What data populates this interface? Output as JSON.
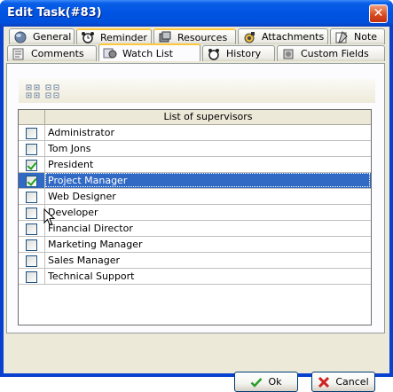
{
  "window": {
    "title": "Edit Task(#83)",
    "close_glyph": "✕"
  },
  "tabs_row1": [
    {
      "label": "General",
      "icon": "globe-icon"
    },
    {
      "label": "Reminder",
      "icon": "alarm-clock-icon"
    },
    {
      "label": "Resources",
      "icon": "resources-icon"
    },
    {
      "label": "Attachments",
      "icon": "attachment-icon"
    },
    {
      "label": "Note",
      "icon": "note-icon"
    }
  ],
  "tabs_row2": [
    {
      "label": "Comments",
      "icon": "comments-icon"
    },
    {
      "label": "Watch List",
      "icon": "watch-list-icon",
      "selected": true
    },
    {
      "label": "History",
      "icon": "history-icon"
    },
    {
      "label": "Custom Fields",
      "icon": "custom-fields-icon"
    }
  ],
  "toolbar": {
    "buttons": [
      "expand-all-icon",
      "collapse-all-icon"
    ]
  },
  "grid": {
    "header": "List of supervisors",
    "rows": [
      {
        "name": "Administrator",
        "checked": false
      },
      {
        "name": "Tom Jons",
        "checked": false
      },
      {
        "name": "President",
        "checked": true
      },
      {
        "name": "Project Manager",
        "checked": true,
        "selected": true
      },
      {
        "name": "Web Designer",
        "checked": false
      },
      {
        "name": "Developer",
        "checked": false
      },
      {
        "name": "Financial Director",
        "checked": false
      },
      {
        "name": "Marketing Manager",
        "checked": false
      },
      {
        "name": "Sales Manager",
        "checked": false
      },
      {
        "name": "Technical Support",
        "checked": false
      }
    ]
  },
  "buttons": {
    "ok_label": "Ok",
    "cancel_label": "Cancel"
  },
  "colors": {
    "title_bar": "#0054e3",
    "selection": "#316ac5",
    "check": "#21a121",
    "tab_highlight": "#ffc83c"
  }
}
